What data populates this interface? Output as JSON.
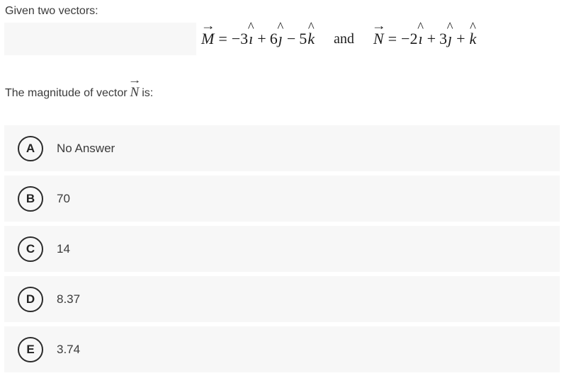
{
  "prompt": {
    "heading": "Given two vectors:"
  },
  "equation": {
    "vector_m": {
      "symbol": "M",
      "terms": [
        {
          "sign": "−",
          "coefficient": "3",
          "unit": "ı"
        },
        {
          "sign": "+",
          "coefficient": "6",
          "unit": "ȷ"
        },
        {
          "sign": "−",
          "coefficient": "5",
          "unit": "k"
        }
      ],
      "plain": "M⃗ = −3ı̂ + 6ȷ̂ − 5k̂"
    },
    "conjunction": "and",
    "vector_n": {
      "symbol": "N",
      "terms": [
        {
          "sign": "−",
          "coefficient": "2",
          "unit": "ı"
        },
        {
          "sign": "+",
          "coefficient": "3",
          "unit": "ȷ"
        },
        {
          "sign": "+",
          "coefficient": "",
          "unit": "k"
        }
      ],
      "plain": "N⃗ = −2ı̂ + 3ȷ̂ + k̂"
    },
    "equals": "="
  },
  "question": {
    "prefix": "The magnitude of vector",
    "vector_symbol": "N",
    "suffix": "is:"
  },
  "options": [
    {
      "letter": "A",
      "label": "No Answer"
    },
    {
      "letter": "B",
      "label": "70"
    },
    {
      "letter": "C",
      "label": "14"
    },
    {
      "letter": "D",
      "label": "8.37"
    },
    {
      "letter": "E",
      "label": "3.74"
    }
  ],
  "colors": {
    "row_background": "#f7f7f7",
    "page_background": "#ffffff",
    "text": "#3b3b3b",
    "badge_border": "#2b2b2b",
    "math_text": "#1c1c1c"
  }
}
